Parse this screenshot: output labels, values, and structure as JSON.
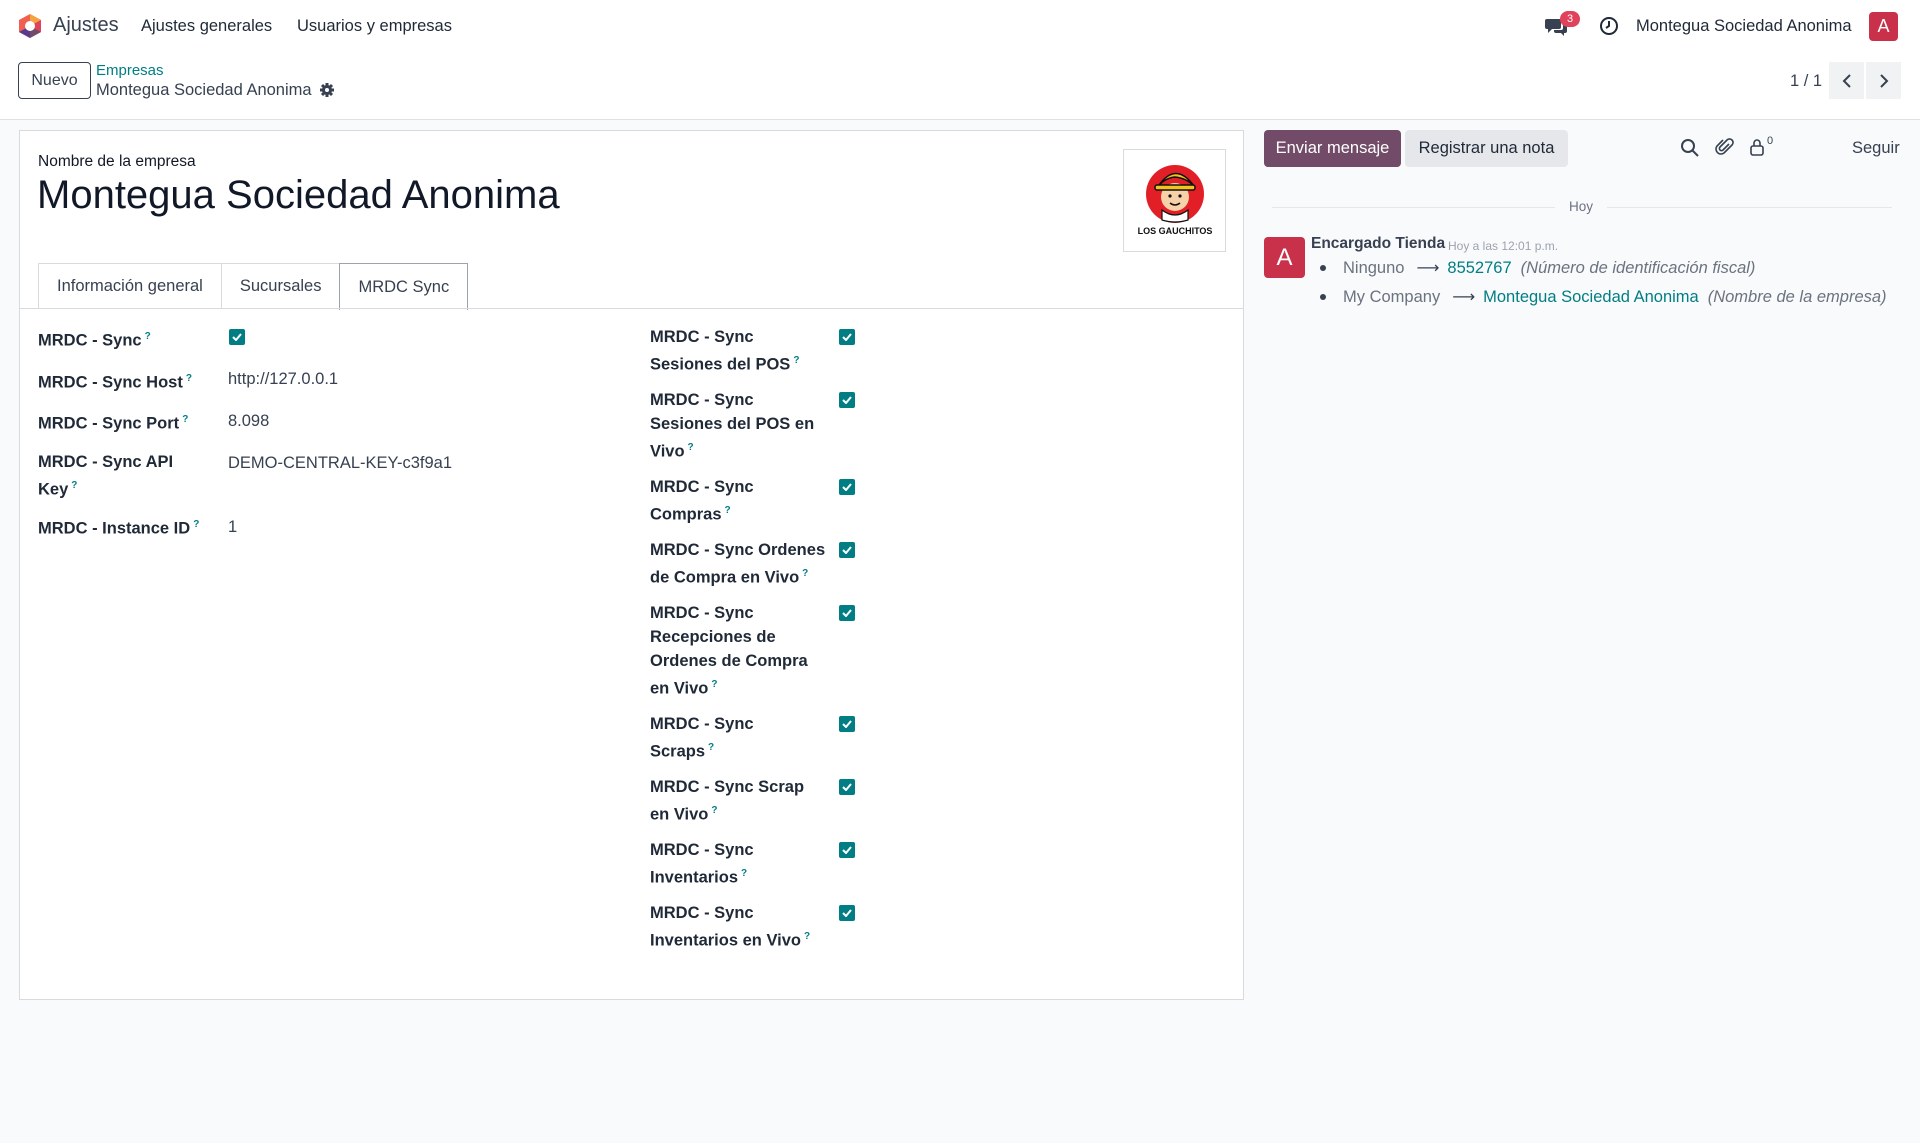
{
  "topbar": {
    "app_name": "Ajustes",
    "menu": [
      "Ajustes generales",
      "Usuarios y empresas"
    ],
    "chat_badge": "3",
    "company": "Montegua Sociedad Anonima",
    "avatar_letter": "A"
  },
  "control": {
    "new_button": "Nuevo",
    "breadcrumb_parent": "Empresas",
    "breadcrumb_current": "Montegua Sociedad Anonima",
    "pager": "1 / 1"
  },
  "form": {
    "name_label": "Nombre de la empresa",
    "name_value": "Montegua Sociedad Anonima",
    "logo_text": "LOS GAUCHITOS",
    "tabs": [
      "Información general",
      "Sucursales",
      "MRDC Sync"
    ],
    "left_fields": [
      {
        "label": "MRDC - Sync",
        "type": "checkbox",
        "checked": true
      },
      {
        "label": "MRDC - Sync Host",
        "value": "http://127.0.0.1"
      },
      {
        "label": "MRDC - Sync Port",
        "value": "8.098"
      },
      {
        "label_line1": "MRDC - Sync API",
        "label_line2": "Key",
        "value": "DEMO-CENTRAL-KEY-c3f9a1"
      },
      {
        "label": "MRDC - Instance ID",
        "value": "1"
      }
    ],
    "right_fields": [
      {
        "lines": [
          "MRDC - Sync",
          "Sesiones del POS"
        ],
        "checked": true
      },
      {
        "lines": [
          "MRDC - Sync",
          "Sesiones del POS en",
          "Vivo"
        ],
        "checked": true
      },
      {
        "lines": [
          "MRDC - Sync",
          "Compras"
        ],
        "checked": true
      },
      {
        "lines": [
          "MRDC - Sync Ordenes",
          "de Compra en Vivo"
        ],
        "checked": true
      },
      {
        "lines": [
          "MRDC - Sync",
          "Recepciones de",
          "Ordenes de Compra",
          "en Vivo"
        ],
        "checked": true
      },
      {
        "lines": [
          "MRDC - Sync",
          "Scraps"
        ],
        "checked": true
      },
      {
        "lines": [
          "MRDC - Sync Scrap",
          "en Vivo"
        ],
        "checked": true
      },
      {
        "lines": [
          "MRDC - Sync",
          "Inventarios"
        ],
        "checked": true
      },
      {
        "lines": [
          "MRDC - Sync",
          "Inventarios en Vivo"
        ],
        "checked": true
      }
    ],
    "help_mark": "?"
  },
  "chatter": {
    "send_button": "Enviar mensaje",
    "note_button": "Registrar una nota",
    "follower_count": "0",
    "follow_label": "Seguir",
    "day_label": "Hoy",
    "message": {
      "avatar_letter": "A",
      "author": "Encargado Tienda",
      "date": "Hoy a las 12:01 p.m.",
      "changes": [
        {
          "old": "Ninguno",
          "new": "8552767",
          "field": "(Número de identificación fiscal)"
        },
        {
          "old": "My Company",
          "new": "Montegua Sociedad Anonima",
          "field": "(Nombre de la empresa)"
        }
      ]
    }
  },
  "colors": {
    "primary": "#714b67",
    "accent": "#017e84",
    "avatar": "#c9304a",
    "badge": "#e0415b"
  }
}
